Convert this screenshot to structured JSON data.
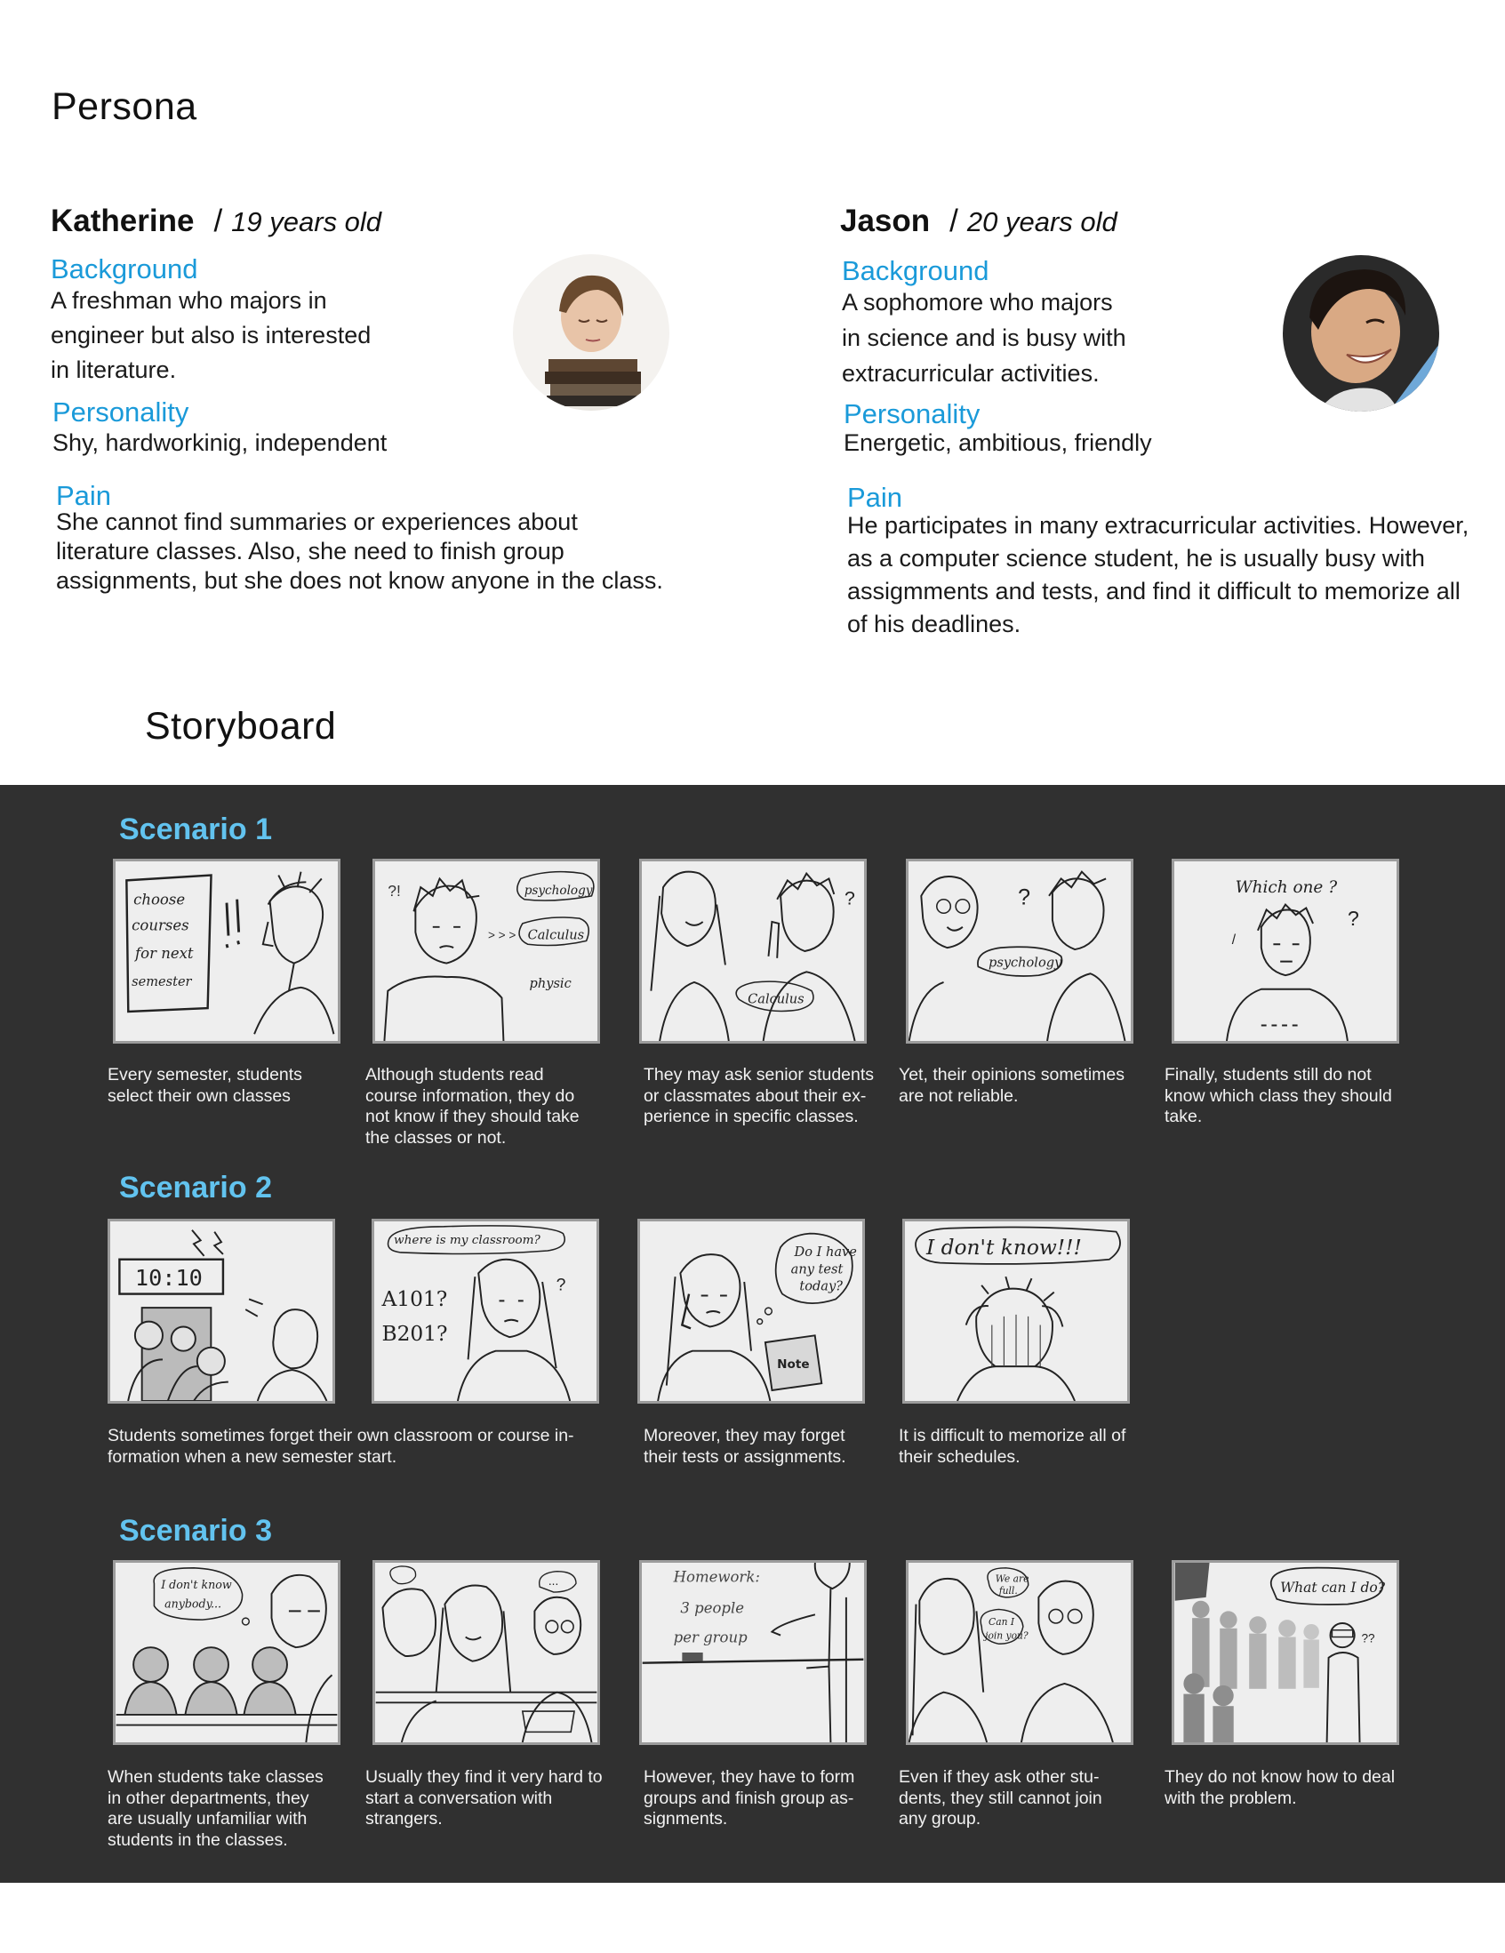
{
  "persona_title": "Persona",
  "storyboard_title": "Storyboard",
  "personas": [
    {
      "name": "Katherine",
      "slash": "/",
      "age": "19 years old",
      "background_label": "Background",
      "background_lines": [
        "A freshman who majors in",
        "engineer but also is interested",
        "in literature."
      ],
      "personality_label": "Personality",
      "personality": "Shy, hardworkinig, independent",
      "pain_label": "Pain",
      "pain_lines": [
        "She cannot find summaries or experiences about",
        "literature classes. Also, she need to finish group",
        "assignments, but she does not know anyone in the  class."
      ]
    },
    {
      "name": "Jason",
      "slash": "/",
      "age": "20 years old",
      "background_label": "Background",
      "background_lines": [
        "A sophomore who majors",
        "in science and  is busy with",
        "extracurricular activities."
      ],
      "personality_label": "Personality",
      "personality": "Energetic, ambitious, friendly",
      "pain_label": "Pain",
      "pain_lines": [
        "He participates in many extracurricular activities. However,",
        "as a computer science student, he is usually busy with",
        "assigmments and tests, and find it difficult to memorize all",
        "of his deadlines."
      ]
    }
  ],
  "scenarios": [
    {
      "title": "Scenario 1",
      "panels": [
        {
          "sketch": [
            "choose",
            "courses",
            "for next",
            "semester"
          ],
          "caption": [
            "Every semester, students",
            "select their own classes"
          ]
        },
        {
          "sketch": [
            "psychology",
            "Calculus",
            "physic"
          ],
          "caption": [
            "Although students read",
            "course information, they do",
            "not know if they should take",
            "the classes or not."
          ]
        },
        {
          "sketch": [
            "Calculus"
          ],
          "caption": [
            "They may ask senior students",
            "or classmates about their ex-",
            "perience in specific classes."
          ]
        },
        {
          "sketch": [
            "psychology"
          ],
          "caption": [
            "Yet, their opinions sometimes",
            "are not reliable."
          ]
        },
        {
          "sketch": [
            "Which one ?"
          ],
          "caption": [
            "Finally, students still do not",
            "know which class they should",
            "take."
          ]
        }
      ]
    },
    {
      "title": "Scenario 2",
      "panels": [
        {
          "sketch": [
            "10:10"
          ],
          "caption": [
            "Students sometimes forget their own classroom or course in-",
            "formation when a new semester start."
          ]
        },
        {
          "sketch": [
            "where is my classroom?",
            "A101?",
            "B201?"
          ],
          "caption": []
        },
        {
          "sketch": [
            "Do I have",
            "any test",
            "today?",
            "Note"
          ],
          "caption": [
            "Moreover, they may forget",
            "their tests or assignments."
          ]
        },
        {
          "sketch": [
            "I don't know!!!"
          ],
          "caption": [
            "It is difficult to memorize all of",
            "their schedules."
          ]
        }
      ]
    },
    {
      "title": "Scenario 3",
      "panels": [
        {
          "sketch": [
            "I don't know",
            "anybody..."
          ],
          "caption": [
            "When students take classes",
            "in other departments, they",
            "are usually unfamiliar with",
            "students in the classes."
          ]
        },
        {
          "sketch": [
            "..."
          ],
          "caption": [
            "Usually they find it very hard to",
            "start a conversation with",
            "strangers."
          ]
        },
        {
          "sketch": [
            "Homework:",
            "3 people",
            "per group"
          ],
          "caption": [
            "However, they have to form",
            "groups and  finish group as-",
            "signments."
          ]
        },
        {
          "sketch": [
            "We are",
            "full.",
            "Can I",
            "join you?"
          ],
          "caption": [
            "Even if they ask other stu-",
            "dents, they still cannot join",
            "any group."
          ]
        },
        {
          "sketch": [
            "What can I do?"
          ],
          "caption": [
            "They do not know how to deal",
            "with the problem."
          ]
        }
      ]
    }
  ]
}
